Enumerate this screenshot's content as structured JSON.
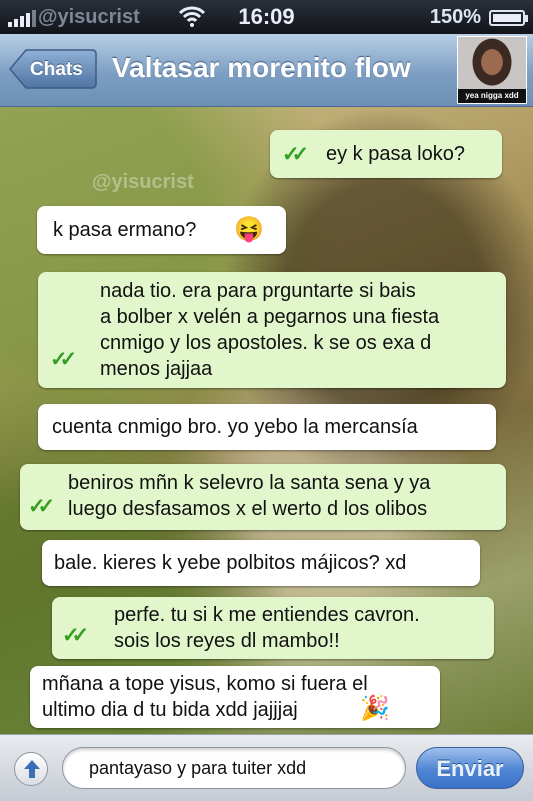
{
  "status_bar": {
    "carrier": "@yisucrist",
    "time": "16:09",
    "battery_percent": "150%",
    "battery_level": 1.0
  },
  "nav": {
    "back_label": "Chats",
    "title": "Valtasar morenito flow",
    "avatar_caption": "yea nigga xdd"
  },
  "chat": {
    "watermark": "@yisucrist",
    "messages": [
      {
        "direction": "out",
        "text": "ey k pasa loko?",
        "ticks": "✓✓"
      },
      {
        "direction": "in",
        "text": "k pasa ermano?",
        "emoji": "😝"
      },
      {
        "direction": "out",
        "text": "nada tio. era para prguntarte si bais\na bolber x velén a pegarnos una fiesta\ncnmigo y los apostoles. k se os exa d\nmenos jajjaa",
        "ticks": "✓✓"
      },
      {
        "direction": "in",
        "text": "cuenta cnmigo bro. yo yebo la mercansía"
      },
      {
        "direction": "out",
        "text": "beniros mñn k selevro la santa sena y ya\nluego desfasamos x el werto d los olibos",
        "ticks": "✓✓"
      },
      {
        "direction": "in",
        "text": "bale. kieres k yebe polbitos májicos? xd"
      },
      {
        "direction": "out",
        "text": "perfe. tu si k me entiendes cavron.\nsois los reyes dl mambo!!",
        "ticks": "✓✓"
      },
      {
        "direction": "in",
        "text": "mñana a tope yisus, komo si fuera el\nultimo dia d tu bida xdd jajjjaj",
        "emoji": "🎉"
      }
    ]
  },
  "input": {
    "value": "pantayaso y para tuiter xdd",
    "send_label": "Enviar"
  },
  "colors": {
    "outgoing_bubble": "#e1f7cb",
    "incoming_bubble": "#ffffff",
    "tick_color": "#33a022",
    "send_button": "#4f85d3"
  }
}
